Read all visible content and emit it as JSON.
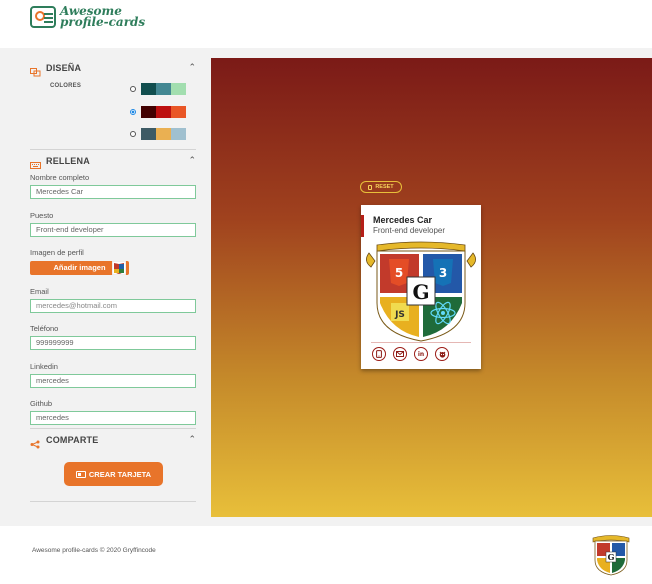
{
  "header": {
    "logo_line1": "Awesome",
    "logo_line2": "profile-cards"
  },
  "design": {
    "title": "DISEÑA",
    "colors_label": "COLORES",
    "palettes": [
      {
        "checked": false,
        "colors": [
          "#114e4e",
          "#438792",
          "#a2deaf"
        ]
      },
      {
        "checked": true,
        "colors": [
          "#420101",
          "#bd1010",
          "#e95626"
        ]
      },
      {
        "checked": false,
        "colors": [
          "#3e5b65",
          "#eab052",
          "#a0c0cf"
        ]
      }
    ]
  },
  "fill": {
    "title": "RELLENA",
    "name_label": "Nombre completo",
    "name_value": "Mercedes Car",
    "job_label": "Puesto",
    "job_value": "Front-end developer",
    "image_label": "Imagen de perfil",
    "upload_button": "Añadir imagen",
    "email_label": "Email",
    "email_placeholder": "mercedes@hotmail.com",
    "phone_label": "Teléfono",
    "phone_value": "999999999",
    "linkedin_label": "Linkedin",
    "linkedin_value": "mercedes",
    "github_label": "Github",
    "github_value": "mercedes"
  },
  "share": {
    "title": "COMPARTE",
    "create_button": "CREAR TARJETA"
  },
  "preview": {
    "reset_label": "RESET",
    "card_name": "Mercedes Car",
    "card_job": "Front-end developer"
  },
  "footer": {
    "text": "Awesome profile-cards © 2020 Gryffincode"
  },
  "icons": {
    "design": "palette-icon",
    "fill": "keyboard-icon",
    "share": "share-icon",
    "card_phone": "mobile-icon",
    "card_email": "envelope-icon",
    "card_linkedin": "linkedin-icon",
    "card_github": "github-icon"
  },
  "colors": {
    "accent": "#e8742a",
    "brand_green": "#2e7d5b",
    "input_border": "#7fc99a",
    "card_accent": "#b51f18"
  }
}
